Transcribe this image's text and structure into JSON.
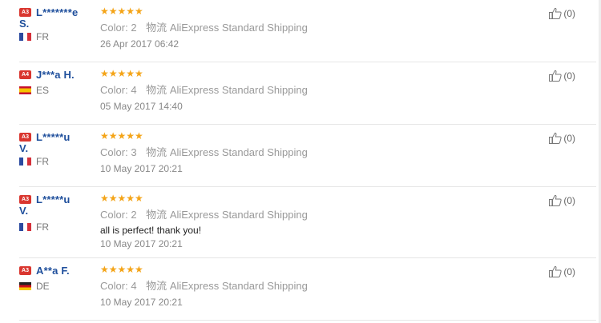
{
  "reviews": [
    {
      "level": "A3",
      "name_line1": "L*******e",
      "name_line2": "S.",
      "country": "FR",
      "flag": "fr",
      "stars": "★★★★★",
      "color_label": "Color:",
      "color_value": "2",
      "ship_label": "物流",
      "shipping": "AliExpress Standard Shipping",
      "feedback": "",
      "date": "26 Apr 2017 06:42",
      "helpful": "(0)"
    },
    {
      "level": "A4",
      "name_line1": "J***a H.",
      "name_line2": "",
      "country": "ES",
      "flag": "es",
      "stars": "★★★★★",
      "color_label": "Color:",
      "color_value": "4",
      "ship_label": "物流",
      "shipping": "AliExpress Standard Shipping",
      "feedback": "",
      "date": "05 May 2017 14:40",
      "helpful": "(0)"
    },
    {
      "level": "A3",
      "name_line1": "L*****u",
      "name_line2": "V.",
      "country": "FR",
      "flag": "fr",
      "stars": "★★★★★",
      "color_label": "Color:",
      "color_value": "3",
      "ship_label": "物流",
      "shipping": "AliExpress Standard Shipping",
      "feedback": "",
      "date": "10 May 2017 20:21",
      "helpful": "(0)"
    },
    {
      "level": "A3",
      "name_line1": "L*****u",
      "name_line2": "V.",
      "country": "FR",
      "flag": "fr",
      "stars": "★★★★★",
      "color_label": "Color:",
      "color_value": "2",
      "ship_label": "物流",
      "shipping": "AliExpress Standard Shipping",
      "feedback": "all is perfect! thank you!",
      "date": "10 May 2017 20:21",
      "helpful": "(0)"
    },
    {
      "level": "A3",
      "name_line1": "A**a F.",
      "name_line2": "",
      "country": "DE",
      "flag": "de",
      "stars": "★★★★★",
      "color_label": "Color:",
      "color_value": "4",
      "ship_label": "物流",
      "shipping": "AliExpress Standard Shipping",
      "feedback": "",
      "date": "10 May 2017 20:21",
      "helpful": "(0)"
    }
  ],
  "colors": {
    "username": "#1f4f9c",
    "star": "#f4a418",
    "level_badge": "#d9362f"
  }
}
